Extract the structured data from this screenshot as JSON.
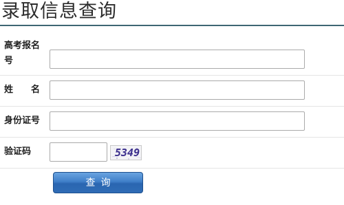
{
  "page": {
    "title": "录取信息查询"
  },
  "form": {
    "exam_number": {
      "label": "高考报名号",
      "value": ""
    },
    "name": {
      "label": "姓　　名",
      "value": ""
    },
    "id_number": {
      "label": "身份证号",
      "value": ""
    },
    "captcha": {
      "label": "验证码",
      "value": "",
      "image_text": "5349"
    },
    "submit_label": "查询"
  },
  "colors": {
    "title_rule": "#3e6673",
    "button_top": "#6aa4e0",
    "button_bottom": "#2a66b1",
    "captcha_text": "#3a2d8c"
  }
}
